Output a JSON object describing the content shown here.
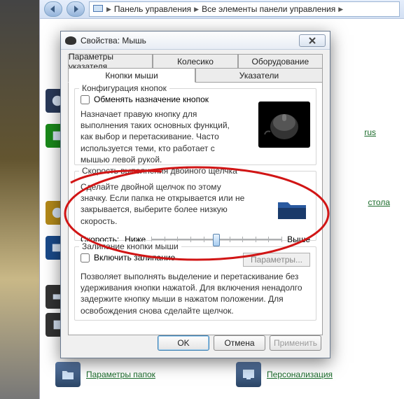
{
  "explorer": {
    "crumb1": "Панель управления",
    "crumb2": "Все элементы панели управления",
    "cp_items": {
      "rus": "rus",
      "stola": "стола",
      "papok": "Параметры папок",
      "personal": "Персонализация"
    }
  },
  "dialog": {
    "title": "Свойства: Мышь",
    "tabs": {
      "top": [
        "Параметры указателя",
        "Колесико",
        "Оборудование"
      ],
      "bottom": [
        "Кнопки мыши",
        "Указатели"
      ],
      "active": "Кнопки мыши"
    },
    "group1": {
      "title": "Конфигурация кнопок",
      "checkbox": "Обменять назначение кнопок",
      "desc": "Назначает правую кнопку для выполнения таких основных функций, как выбор и перетаскивание. Часто используется теми, кто работает с мышью левой рукой."
    },
    "group2": {
      "title": "Скорость выполнения двойного щелчка",
      "desc": "Сделайте двойной щелчок по этому значку. Если папка не открывается или не закрывается, выберите более низкую скорость.",
      "speed_label": "Скорость:",
      "low": "Ниже",
      "high": "Выше"
    },
    "group3": {
      "title": "Залипание кнопки мыши",
      "checkbox": "Включить залипание",
      "params_btn": "Параметры...",
      "desc": "Позволяет выполнять выделение и перетаскивание без удерживания кнопки нажатой. Для включения ненадолго задержите кнопку мыши в нажатом положении. Для освобождения снова сделайте щелчок."
    },
    "buttons": {
      "ok": "OK",
      "cancel": "Отмена",
      "apply": "Применить"
    }
  }
}
